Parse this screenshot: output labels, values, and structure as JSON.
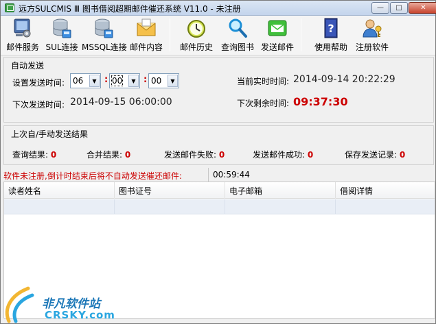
{
  "window": {
    "title": "远方SULCMIS Ⅲ 图书借阅超期邮件催还系统 V11.0 - 未注册",
    "minimize": "—",
    "maximize": "□",
    "close": "✕"
  },
  "toolbar": [
    {
      "label": "邮件服务",
      "icon": "server-icon"
    },
    {
      "label": "SUL连接",
      "icon": "database-icon"
    },
    {
      "label": "MSSQL连接",
      "icon": "database-icon"
    },
    {
      "label": "邮件内容",
      "icon": "envelope-icon"
    },
    {
      "label": "邮件历史",
      "icon": "clock-icon"
    },
    {
      "label": "查询图书",
      "icon": "magnifier-icon"
    },
    {
      "label": "发送邮件",
      "icon": "send-mail-icon"
    },
    {
      "label": "使用帮助",
      "icon": "help-book-icon"
    },
    {
      "label": "注册软件",
      "icon": "user-key-icon"
    }
  ],
  "auto_send": {
    "title": "自动发送",
    "set_time_label": "设置发送时间:",
    "hour": "06",
    "minute": "00",
    "second": "00",
    "current_time_label": "当前实时时间:",
    "current_time": "2014-09-14 20:22:29",
    "next_send_label": "下次发送时间:",
    "next_send": "2014-09-15 06:00:00",
    "remaining_label": "下次剩余时间:",
    "remaining": "09:37:30"
  },
  "results": {
    "title": "上次自/手动发送结果",
    "items": [
      {
        "label": "查询结果:",
        "value": "0"
      },
      {
        "label": "合并结果:",
        "value": "0"
      },
      {
        "label": "发送邮件失败:",
        "value": "0"
      },
      {
        "label": "发送邮件成功:",
        "value": "0"
      },
      {
        "label": "保存发送记录:",
        "value": "0"
      }
    ]
  },
  "status": {
    "warning": "软件未注册,倒计时结束后将不自动发送催还邮件:",
    "countdown": "00:59:44"
  },
  "table": {
    "columns": [
      "读者姓名",
      "图书证号",
      "电子邮箱",
      "借阅详情"
    ]
  },
  "watermark": {
    "line1": "非凡软件站",
    "line2": "CRSKY.com"
  },
  "colors": {
    "accent_red": "#cc0000",
    "title_gradient_top": "#dbe6f4"
  }
}
